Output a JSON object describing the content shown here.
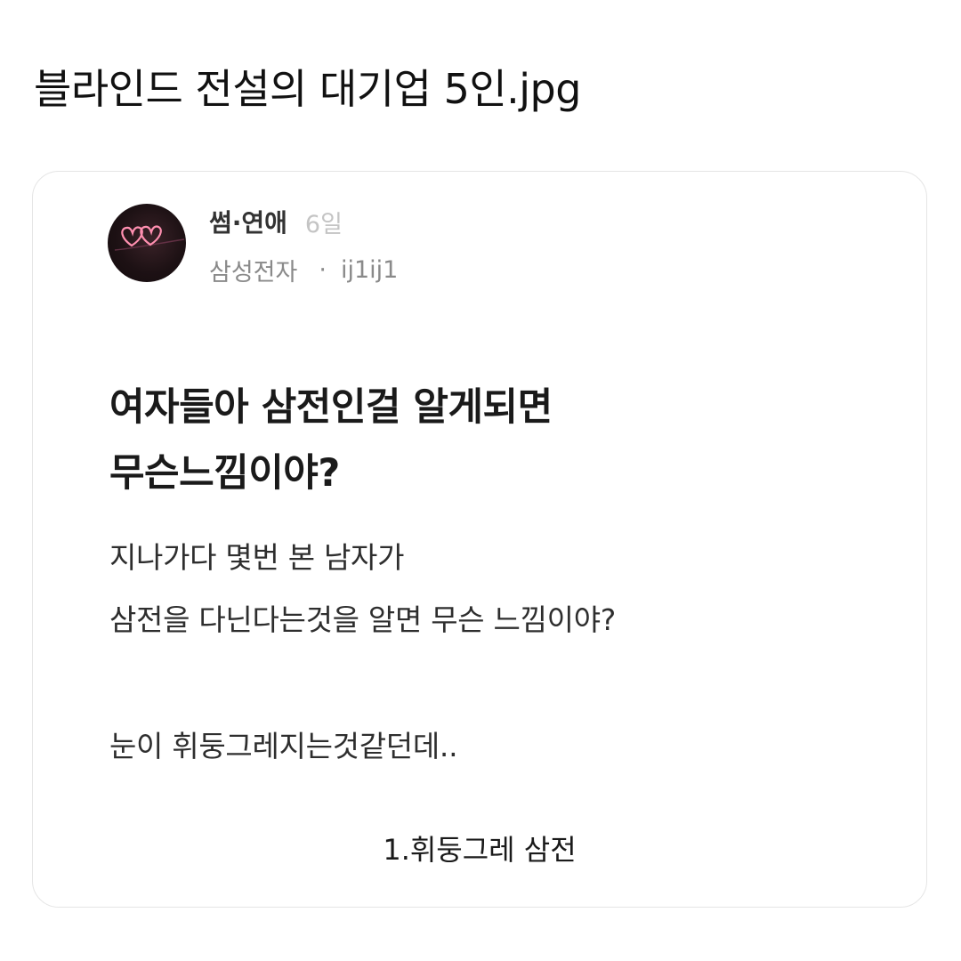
{
  "post": {
    "title": "블라인드 전설의 대기업 5인.jpg"
  },
  "card": {
    "avatar_icon": "heart-neon-icon",
    "board_name": "썸·연애",
    "time": "6일",
    "company": "삼성전자",
    "separator": "·",
    "username": "ij1ij1",
    "headline_line1": "여자들아 삼전인걸 알게되면",
    "headline_line2": "무슨느낌이야?",
    "body_line1": "지나가다 몇번 본 남자가",
    "body_line2": "삼전을 다닌다는것을 알면 무슨 느낌이야?",
    "body_line3": "눈이 휘둥그레지는것같던데..",
    "caption": "1.휘둥그레 삼전"
  },
  "colors": {
    "neon_pink": "#ff8fb0"
  }
}
